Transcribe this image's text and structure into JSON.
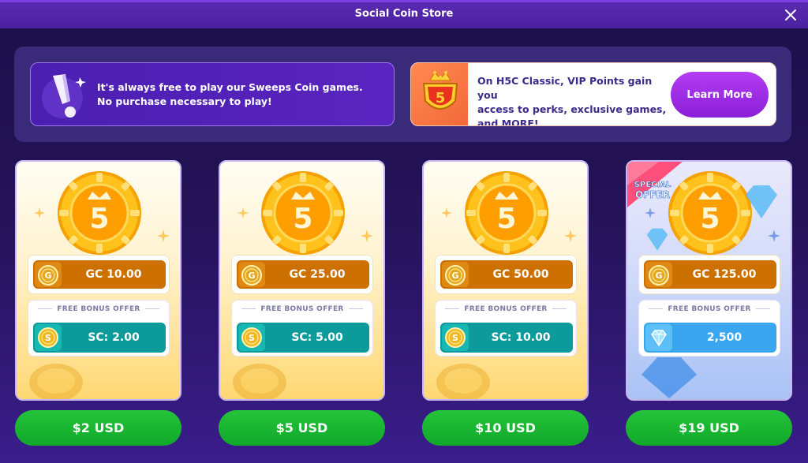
{
  "window": {
    "title": "Social Coin Store"
  },
  "banners": {
    "free_play": {
      "line1": "It's always free to play our Sweeps Coin games.",
      "line2": "No purchase necessary to play!"
    },
    "vip": {
      "line1": "On H5C Classic, VIP Points gain you",
      "line2": "access to perks, exclusive games,",
      "line3": "and MORE!",
      "button_label": "Learn More"
    }
  },
  "packages": [
    {
      "gc": "GC 10.00",
      "bonus_label": "FREE BONUS OFFER",
      "bonus": "SC: 2.00",
      "price": "$2 USD"
    },
    {
      "gc": "GC 25.00",
      "bonus_label": "FREE BONUS OFFER",
      "bonus": "SC: 5.00",
      "price": "$5 USD"
    },
    {
      "gc": "GC 50.00",
      "bonus_label": "FREE BONUS OFFER",
      "bonus": "SC: 10.00",
      "price": "$10 USD"
    },
    {
      "gc": "GC 125.00",
      "bonus_label": "FREE BONUS OFFER",
      "bonus": "2,500",
      "price": "$19 USD",
      "badge": "SPECIAL OFFER"
    }
  ],
  "colors": {
    "gc_pill": "#cc7000",
    "sc_pill": "#0c9a9a",
    "gem_pill": "#3aa6f0",
    "buy_button": "#10a82a",
    "learn_more": "#8a1fd8"
  },
  "icons": {
    "close": "close-icon",
    "info": "exclamation-icon",
    "brand": "h5c-crown-logo",
    "gold_coin": "gold-coin-icon",
    "sweeps_coin": "sweeps-coin-icon",
    "gem": "diamond-icon"
  }
}
